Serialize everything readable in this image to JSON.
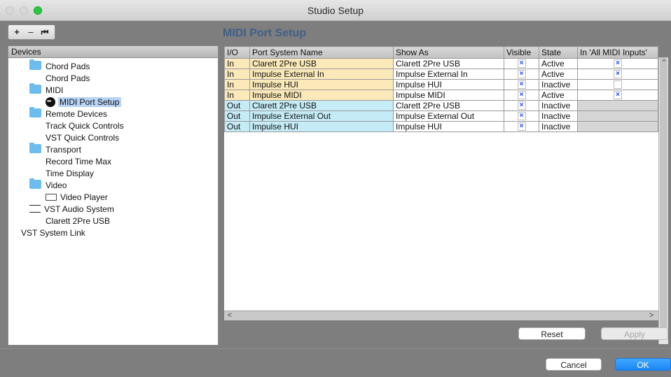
{
  "window": {
    "title": "Studio Setup"
  },
  "toolbar": {
    "add": "+",
    "remove": "–",
    "reset": "⏮"
  },
  "devices_panel": {
    "header": "Devices"
  },
  "tree": {
    "chord_pads_folder": "Chord Pads",
    "chord_pads": "Chord Pads",
    "midi_folder": "MIDI",
    "midi_port_setup": "MIDI Port Setup",
    "remote_devices_folder": "Remote Devices",
    "track_quick_controls": "Track Quick Controls",
    "vst_quick_controls": "VST Quick Controls",
    "transport_folder": "Transport",
    "record_time_max": "Record Time Max",
    "time_display": "Time Display",
    "video_folder": "Video",
    "video_player": "Video Player",
    "vst_audio_system": "VST Audio System",
    "clarett": "Clarett 2Pre USB",
    "vst_system_link": "VST System Link"
  },
  "section": {
    "title": "MIDI Port Setup"
  },
  "table": {
    "headers": {
      "io": "I/O",
      "name": "Port System Name",
      "show_as": "Show As",
      "visible": "Visible",
      "state": "State",
      "all_midi": "In 'All MIDI Inputs'"
    },
    "rows": [
      {
        "io": "In",
        "name": "Clarett 2Pre USB",
        "show_as": "Clarett 2Pre USB",
        "visible": "×",
        "state": "Active",
        "all_midi": "×"
      },
      {
        "io": "In",
        "name": "Impulse External In",
        "show_as": "Impulse External In",
        "visible": "×",
        "state": "Active",
        "all_midi": "×"
      },
      {
        "io": "In",
        "name": "Impulse HUI",
        "show_as": "Impulse HUI",
        "visible": "×",
        "state": "Inactive",
        "all_midi": ""
      },
      {
        "io": "In",
        "name": "Impulse MIDI",
        "show_as": "Impulse MIDI",
        "visible": "×",
        "state": "Active",
        "all_midi": "×"
      },
      {
        "io": "Out",
        "name": "Clarett 2Pre USB",
        "show_as": "Clarett 2Pre USB",
        "visible": "×",
        "state": "Inactive"
      },
      {
        "io": "Out",
        "name": "Impulse External Out",
        "show_as": "Impulse External Out",
        "visible": "×",
        "state": "Inactive"
      },
      {
        "io": "Out",
        "name": "Impulse HUI",
        "show_as": "Impulse HUI",
        "visible": "×",
        "state": "Inactive"
      }
    ]
  },
  "scroll": {
    "up": "⌃",
    "down": "⌄",
    "left": "<",
    "right": ">"
  },
  "buttons": {
    "reset": "Reset",
    "apply": "Apply",
    "cancel": "Cancel",
    "ok": "OK"
  },
  "colors": {
    "in_row": "#fbe9b9",
    "out_row": "#c4ebf6",
    "selection": "#b7d4f6",
    "title_accent": "#3e5f86",
    "ok_button": "#1b86f6"
  }
}
